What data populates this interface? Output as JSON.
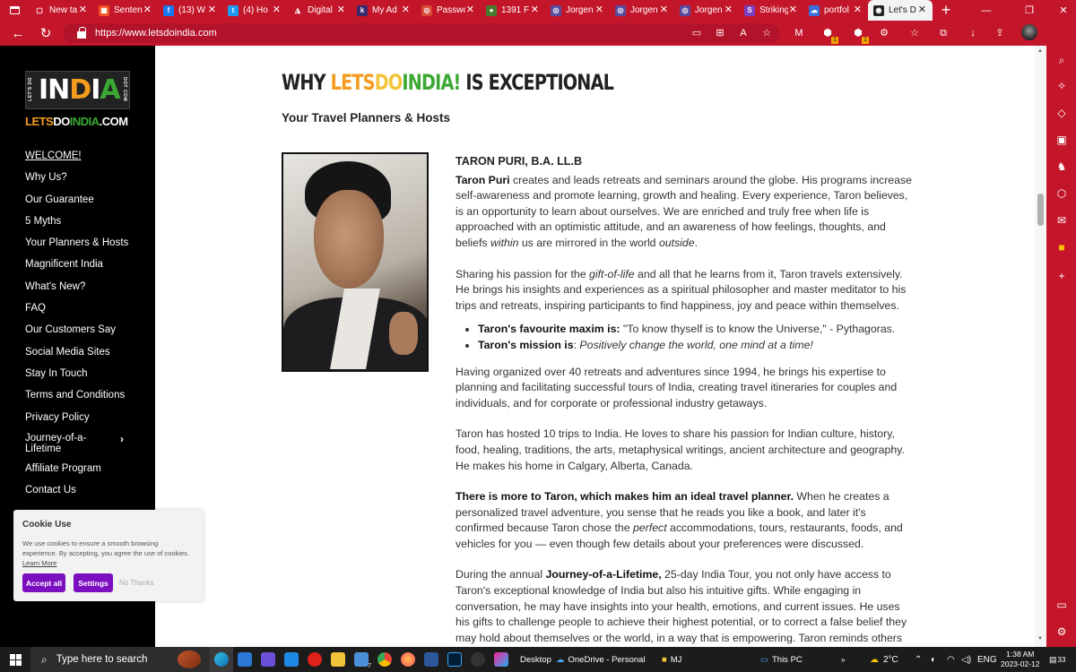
{
  "browser": {
    "tabs": [
      {
        "label": "New ta",
        "fav_color": "#c4162a",
        "fav_glyph": "▢",
        "active": false
      },
      {
        "label": "Senten",
        "fav_color": "#f25022",
        "fav_glyph": "▦",
        "active": false
      },
      {
        "label": "(13) W",
        "fav_color": "#1877f2",
        "fav_glyph": "f",
        "active": false
      },
      {
        "label": "(4) Ho",
        "fav_color": "#1d9bf0",
        "fav_glyph": "t",
        "active": false
      },
      {
        "label": "Digital",
        "fav_color": "#c4162a",
        "fav_glyph": "◮",
        "active": false
      },
      {
        "label": "My Ad",
        "fav_color": "#3c2a6e",
        "fav_glyph": "k",
        "active": false
      },
      {
        "label": "Passwo",
        "fav_color": "#d8473a",
        "fav_glyph": "◎",
        "active": false
      },
      {
        "label": "1391 F",
        "fav_color": "#4a7a2e",
        "fav_glyph": "●",
        "active": false
      },
      {
        "label": "Jorgen",
        "fav_color": "#5a4a9e",
        "fav_glyph": "◎",
        "active": false
      },
      {
        "label": "Jorgen",
        "fav_color": "#5a4a9e",
        "fav_glyph": "◎",
        "active": false
      },
      {
        "label": "Jorgen",
        "fav_color": "#5a4a9e",
        "fav_glyph": "◎",
        "active": false
      },
      {
        "label": "Striking",
        "fav_color": "#7b3fbf",
        "fav_glyph": "S",
        "active": false
      },
      {
        "label": "portfol",
        "fav_color": "#3a6fd8",
        "fav_glyph": "☁",
        "active": false
      },
      {
        "label": "Let's D",
        "fav_color": "#222222",
        "fav_glyph": "◉",
        "active": true
      }
    ],
    "url": "https://www.letsdoindia.com",
    "toolbar_badges": {
      "ext1": "1",
      "ext2": "1"
    }
  },
  "sidebar": {
    "logo": {
      "side_left": "LET'S DO",
      "main_pre": "IN",
      "main_o": "D",
      "main_i": "I",
      "main_a": "A",
      "side_right": "DOT COM"
    },
    "logo_text": {
      "lets": "LETS",
      "do": "DO",
      "india": "INDIA",
      "dot": ".COM"
    },
    "menu": [
      "WELCOME!",
      "Why Us?",
      "Our Guarantee",
      "5 Myths",
      "Your Planners & Hosts",
      "Magnificent India",
      "What's New?",
      "FAQ",
      "Our Customers Say",
      "Social Media Sites",
      "Stay In Touch",
      "Terms and Conditions",
      "Privacy Policy",
      "Journey-of-a-Lifetime",
      "Affiliate Program",
      "Contact Us"
    ]
  },
  "cookie": {
    "title": "Cookie Use",
    "text": "We use cookies to ensure a smooth browsing experience. By accepting, you agree the use of cookies.",
    "learn_more": "Learn More",
    "accept": "Accept all",
    "settings": "Settings",
    "no_thanks": "No Thanks"
  },
  "main": {
    "heading": {
      "why": "WHY ",
      "lets": "LETS",
      "do": "DO",
      "india": "INDIA!",
      "rest": " IS EXCEPTIONAL"
    },
    "subheading": "Your Travel Planners & Hosts",
    "profile_name": "TARON PURI, B.A. LL.B",
    "p1": {
      "bold": "Taron Puri",
      "text1": " creates and leads retreats and seminars around the globe. His programs increase self-awareness and promote learning, growth and healing. Every experience, Taron believes, is an opportunity to learn about ourselves. We are enriched and truly free when life is approached with an optimistic attitude, and an awareness of how feelings, thoughts, and beliefs ",
      "em1": "within",
      "text2": " us are mirrored in the world ",
      "em2": "outside",
      "text3": "."
    },
    "p2": {
      "text1": "Sharing his passion for the ",
      "em": "gift-of-life",
      "text2": " and all that he learns from it, Taron travels extensively. He brings his insights and experiences as a spiritual philosopher and master meditator to his trips and retreats, inspiring participants to find happiness, joy and peace within themselves."
    },
    "bullets": [
      {
        "bold": "Taron's favourite maxim is:",
        "text": " \"To know thyself is to know the Universe,\" - Pythagoras."
      },
      {
        "bold": "Taron's mission is",
        "text": ": ",
        "em": "Positively change the world, one mind at a time!"
      }
    ],
    "p3": "Having organized over 40 retreats and adventures since 1994, he brings his expertise to planning and facilitating successful tours of India, creating travel itineraries for couples and individuals, and for corporate or professional industry getaways.",
    "p4": "Taron has hosted 10 trips to India. He loves to share his passion for Indian culture, history, food, healing, traditions, the arts, metaphysical writings, ancient architecture and geography. He makes his home in Calgary, Alberta, Canada.",
    "p5": {
      "bold": "There is more to Taron, which makes him an ideal travel planner.",
      "text1": " When he creates a personalized travel adventure, you sense that he reads you like a book, and later it's confirmed because Taron chose the ",
      "em": "perfect",
      "text2": " accommodations, tours, restaurants, foods, and vehicles for you — even though few details about your preferences were discussed."
    },
    "p6": {
      "text1": "During the annual ",
      "bold": "Journey-of-a-Lifetime,",
      "text2": " 25-day India Tour, you not only have access to Taron's exceptional knowledge of India but also his intuitive gifts. While engaging in conversation, he may have insights into your health, emotions, and current issues. He uses his gifts to challenge people to achieve their highest potential, or to correct a false belief they may hold about themselves or the world, in a way that is empowering. Taron reminds others to develop a"
    }
  },
  "taskbar": {
    "search_placeholder": "Type here to search",
    "desktop": "Desktop",
    "onedrive": "OneDrive - Personal",
    "mj": "MJ",
    "thispc": "This PC",
    "weather": "2°C",
    "lang": "ENG",
    "time": "1:38 AM",
    "date": "2023-02-12",
    "notif_count": "33",
    "app_badge": "7"
  }
}
